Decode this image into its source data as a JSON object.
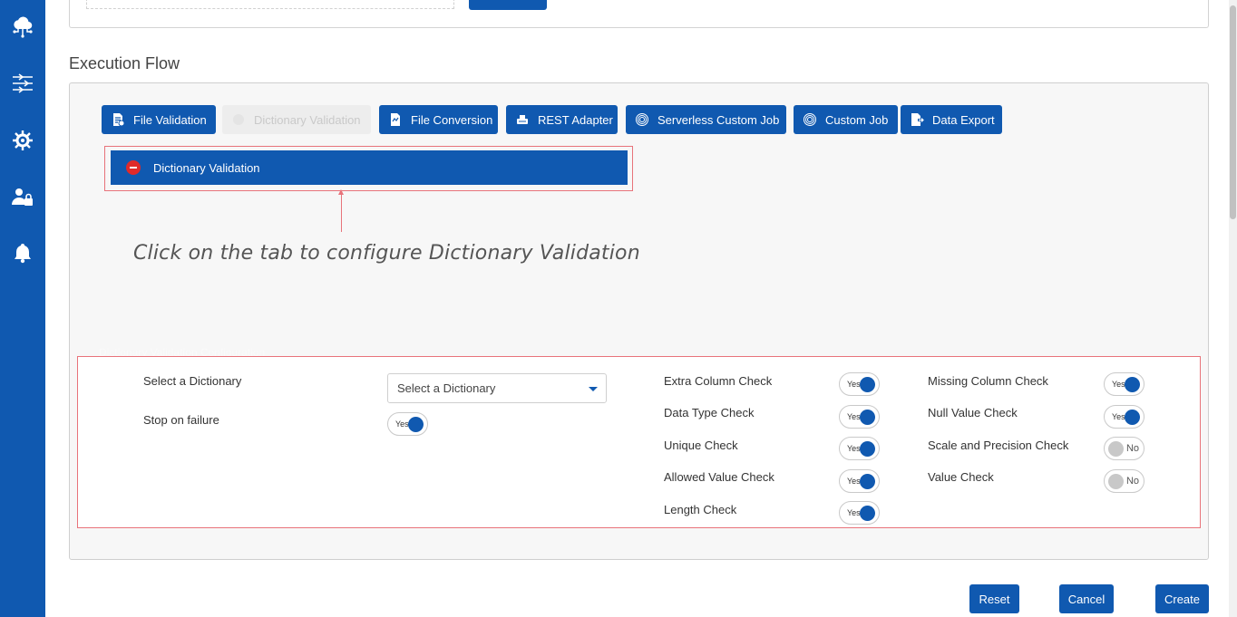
{
  "sidebar": {
    "icons": [
      "cloud-network-icon",
      "data-flow-icon",
      "settings-icon",
      "user-lock-icon",
      "bell-icon"
    ]
  },
  "section": {
    "title": "Execution Flow"
  },
  "tabs": [
    {
      "label": "File Validation",
      "icon": "file-validation-icon"
    },
    {
      "label": "Dictionary Validation",
      "icon": "dictionary-icon",
      "disabled": true
    },
    {
      "label": "File Conversion",
      "icon": "file-conversion-icon"
    },
    {
      "label": "REST Adapter",
      "icon": "rest-adapter-icon"
    },
    {
      "label": "Serverless Custom Job",
      "icon": "fingerprint-icon"
    },
    {
      "label": "Custom Job",
      "icon": "fingerprint-icon"
    },
    {
      "label": "Data Export",
      "icon": "data-export-icon"
    }
  ],
  "flow_step": {
    "label": "Dictionary Validation",
    "icon": "stop-icon"
  },
  "hint": "Click on the tab to configure Dictionary Validation",
  "config": {
    "ghost_title": "Dictionary Validation Configuration",
    "select_label": "Select a Dictionary",
    "select_placeholder": "Select a Dictionary",
    "stop_label": "Stop on failure",
    "stop_value": "Yes",
    "checks_left": [
      {
        "label": "Extra Column Check",
        "value": "Yes"
      },
      {
        "label": "Data Type Check",
        "value": "Yes"
      },
      {
        "label": "Unique Check",
        "value": "Yes"
      },
      {
        "label": "Allowed Value Check",
        "value": "Yes"
      },
      {
        "label": "Length Check",
        "value": "Yes"
      }
    ],
    "checks_right": [
      {
        "label": "Missing Column Check",
        "value": "Yes"
      },
      {
        "label": "Null Value Check",
        "value": "Yes"
      },
      {
        "label": "Scale and Precision Check",
        "value": "No"
      },
      {
        "label": "Value Check",
        "value": "No"
      }
    ]
  },
  "actions": {
    "reset": "Reset",
    "cancel": "Cancel",
    "create": "Create"
  },
  "colors": {
    "primary": "#1059b0",
    "highlight": "#e8737a",
    "stop": "#e02a2a"
  }
}
